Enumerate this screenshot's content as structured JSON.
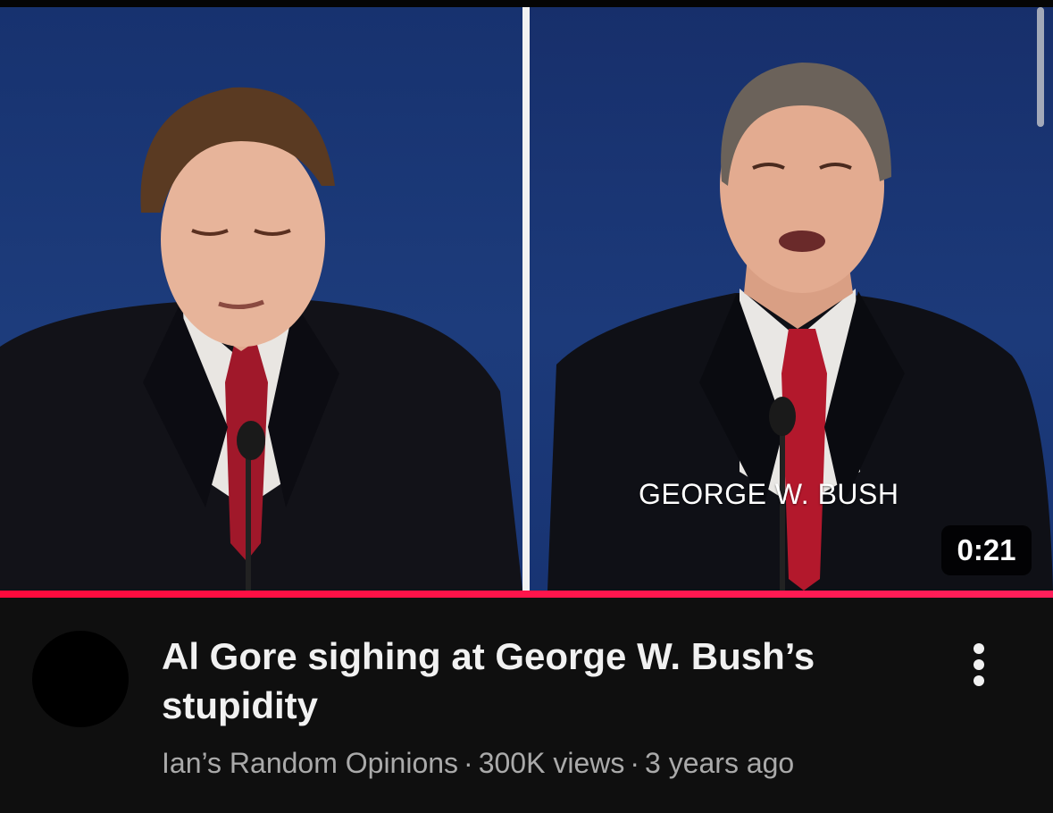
{
  "video": {
    "caption": "GEORGE W. BUSH",
    "duration": "0:21",
    "progress_fraction": 1.0,
    "title": "Al Gore sighing at George W. Bush’s stupidity",
    "channel": "Ian’s Random Opinions",
    "views": "300K views",
    "age": "3 years ago",
    "separator": "·"
  },
  "icons": {
    "menu": "more-vertical-icon",
    "avatar": "channel-avatar"
  },
  "colors": {
    "background": "#0f0f0f",
    "progress": "#ff0a3c",
    "title": "#f1f1f1",
    "meta": "#aaaaaa",
    "stage_blue": "#1d3c7c"
  }
}
